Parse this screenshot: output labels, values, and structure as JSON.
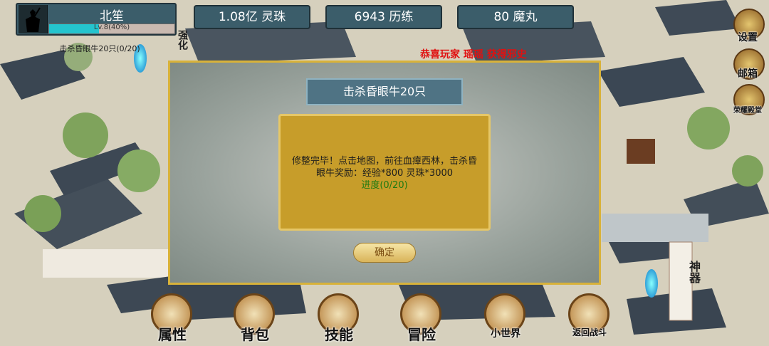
{
  "player": {
    "name": "北笙",
    "level_text": "Lv.8(40%)",
    "level_progress": 0.4
  },
  "quest_tracker": "击杀昏眼牛20只(0/20)",
  "currencies": {
    "spirit_stone": "1.08亿 灵珠",
    "experience": "6943 历练",
    "pill": "80 魔丸"
  },
  "side_labels": {
    "enhance": "强化",
    "shenqi": "神器"
  },
  "right_menu": [
    {
      "label": "设置",
      "icon": "gear-icon"
    },
    {
      "label": "邮箱",
      "icon": "mail-icon"
    },
    {
      "label": "荣耀殿堂",
      "icon": "trophy-icon"
    }
  ],
  "announcement": "恭喜玩家 瑶瑶 获得邪史",
  "modal": {
    "title": "击杀昏眼牛20只",
    "desc_line1": "修整完毕！点击地图，前往血瘴西林，击杀昏",
    "desc_line2": "眼牛奖励：经验*800 灵珠*3000",
    "progress": "进度(0/20)",
    "confirm": "确定"
  },
  "bottom_nav": [
    {
      "label": "属性",
      "icon": "attributes-icon"
    },
    {
      "label": "背包",
      "icon": "backpack-icon"
    },
    {
      "label": "技能",
      "icon": "skills-icon"
    },
    {
      "label": "冒险",
      "icon": "adventure-icon"
    },
    {
      "label": "小世界",
      "icon": "small-world-icon"
    },
    {
      "label": "返回战斗",
      "icon": "return-battle-icon"
    }
  ],
  "colors": {
    "panel": "#3b5d6a",
    "level_fill": "#24c4ce",
    "modal_border": "#d8b23a",
    "task_box": "#c79d2a",
    "announce": "#e01010"
  }
}
